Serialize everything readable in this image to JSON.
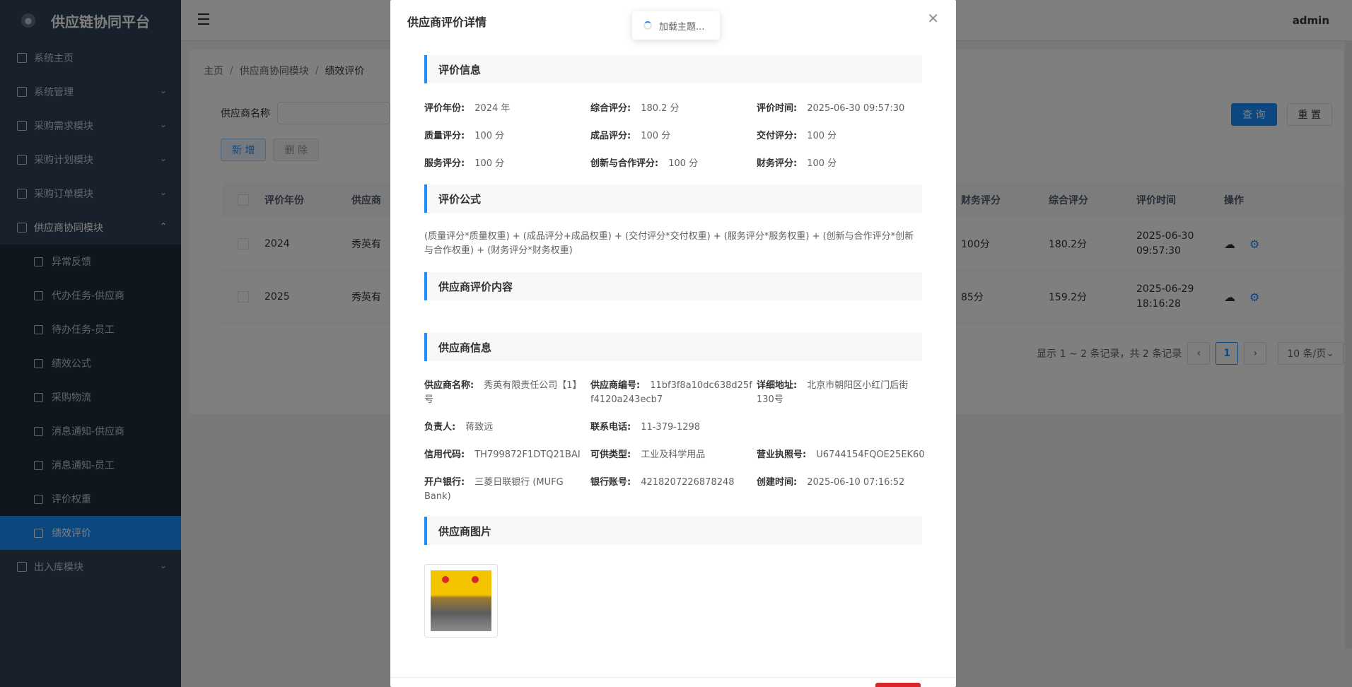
{
  "app": {
    "title": "供应链协同平台",
    "user": "admin"
  },
  "sidebar": {
    "items": [
      {
        "label": "系统主页"
      },
      {
        "label": "系统管理"
      },
      {
        "label": "采购需求模块"
      },
      {
        "label": "采购计划模块"
      },
      {
        "label": "采购订单模块"
      },
      {
        "label": "供应商协同模块"
      }
    ],
    "subitems": [
      {
        "label": "异常反馈"
      },
      {
        "label": "代办任务-供应商"
      },
      {
        "label": "待办任务-员工"
      },
      {
        "label": "绩效公式"
      },
      {
        "label": "采购物流"
      },
      {
        "label": "消息通知-供应商"
      },
      {
        "label": "消息通知-员工"
      },
      {
        "label": "评价权重"
      },
      {
        "label": "绩效评价"
      }
    ],
    "last": {
      "label": "出入库模块"
    }
  },
  "breadcrumb": {
    "home": "主页",
    "parent": "供应商协同模块",
    "current": "绩效评价"
  },
  "search": {
    "supplier_label": "供应商名称",
    "query": "查 询",
    "reset": "重 置"
  },
  "toolbar": {
    "add": "新 增",
    "delete": "删 除"
  },
  "table": {
    "headers": [
      "评价年份",
      "供应商",
      "财务评分",
      "综合评分",
      "评价时间",
      "操作"
    ],
    "rows": [
      {
        "year": "2024",
        "supplier": "秀英有",
        "finance": "100分",
        "total": "180.2分",
        "time": "2025-06-30 09:57:30"
      },
      {
        "year": "2025",
        "supplier": "秀英有",
        "finance": "85分",
        "total": "159.2分",
        "time": "2025-06-29 18:16:28"
      }
    ]
  },
  "pager": {
    "summary": "显示 1 ~ 2 条记录，共 2 条记录",
    "current": "1",
    "size": "10 条/页"
  },
  "toast": {
    "text": "加载主题..."
  },
  "dialog": {
    "title": "供应商评价详情",
    "sections": {
      "eval": "评价信息",
      "formula": "评价公式",
      "content": "供应商评价内容",
      "supplier": "供应商信息",
      "image": "供应商图片"
    },
    "eval": {
      "year_label": "评价年份:",
      "year": "2024 年",
      "total_label": "综合评分:",
      "total": "180.2 分",
      "time_label": "评价时间:",
      "time": "2025-06-30 09:57:30",
      "quality_label": "质量评分:",
      "quality": "100 分",
      "product_label": "成品评分:",
      "product": "100 分",
      "delivery_label": "交付评分:",
      "delivery": "100 分",
      "service_label": "服务评分:",
      "service": "100 分",
      "innovation_label": "创新与合作评分:",
      "innovation": "100 分",
      "finance_label": "财务评分:",
      "finance": "100 分"
    },
    "formula_text": "(质量评分*质量权重) + (成品评分+成品权重) + (交付评分*交付权重) + (服务评分*服务权重) + (创新与合作评分*创新与合作权重) + (财务评分*财务权重)",
    "supplier": {
      "name_label": "供应商名称:",
      "name": "秀英有限责任公司【1】号",
      "code_label": "供应商编号:",
      "code": "11bf3f8a10dc638d25ff4120a243ecb7",
      "addr_label": "详细地址:",
      "addr": "北京市朝阳区小红门后街130号",
      "owner_label": "负责人:",
      "owner": "蒋致远",
      "phone_label": "联系电话:",
      "phone": "11-379-1298",
      "credit_label": "信用代码:",
      "credit": "TH799872F1DTQ21BAI",
      "type_label": "可供类型:",
      "type": "工业及科学用品",
      "license_label": "营业执照号:",
      "license": "U6744154FQOE25EK60",
      "bank_label": "开户银行:",
      "bank": "三菱日联银行 (MUFG Bank)",
      "account_label": "银行账号:",
      "account": "4218207226878248",
      "created_label": "创建时间:",
      "created": "2025-06-10 07:16:52"
    },
    "image_alt_text": "供应商图片"
  },
  "icons": {
    "close": "close-icon",
    "menu": "hamburger-icon",
    "cloud": "cloud-icon",
    "gear": "gear-icon"
  },
  "colors": {
    "primary": "#1890ff",
    "sidebar": "#304156"
  }
}
